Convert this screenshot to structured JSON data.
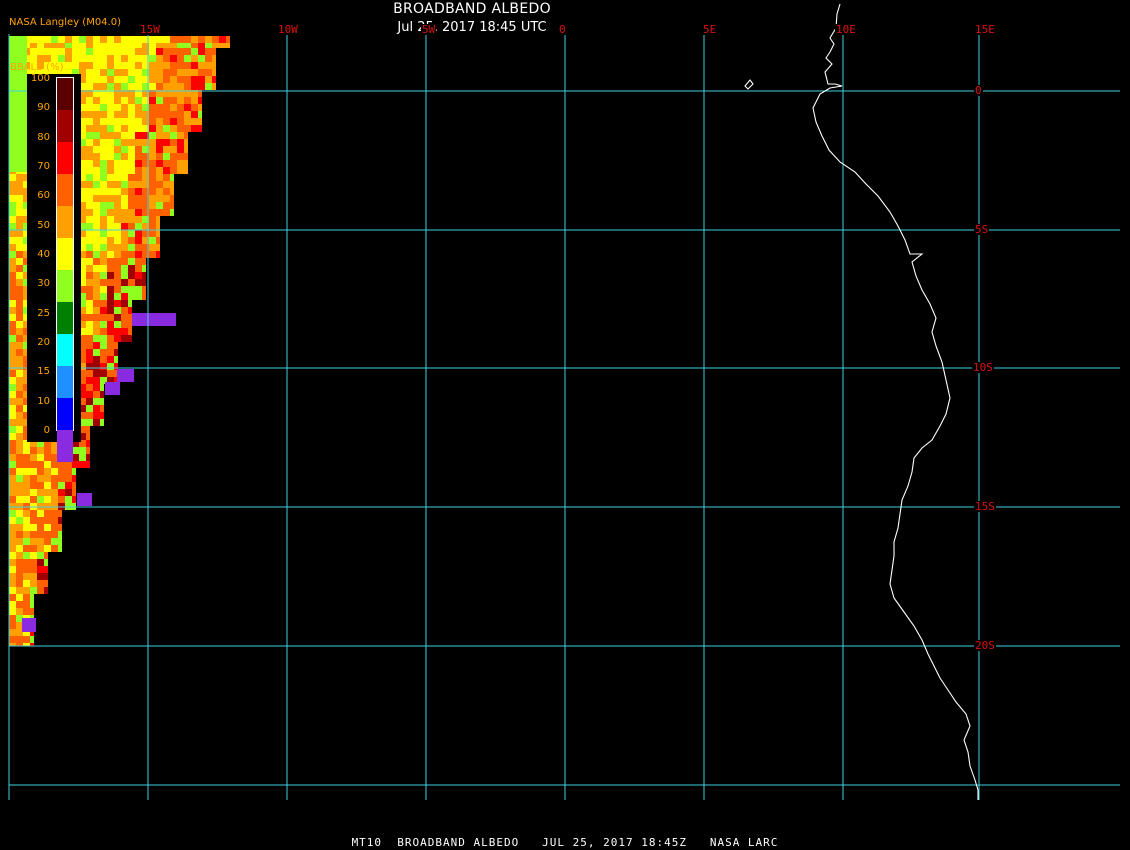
{
  "header": {
    "title": "BROADBAND ALBEDO",
    "timestamp": "Jul 25, 2017 18:45 UTC",
    "producer": "NASA Langley (M04.0)"
  },
  "footer": {
    "text": "MT10  BROADBAND ALBEDO   JUL 25, 2017 18:45Z   NASA LARC"
  },
  "map": {
    "projection": "lat-lon grid",
    "lon_labels": [
      "15W",
      "10W",
      "5W",
      "0",
      "5E",
      "10E",
      "15E"
    ],
    "lat_labels": [
      "0",
      "5S",
      "10S",
      "15S",
      "20S"
    ],
    "grid_color": "#40d0e0",
    "label_color": "#dd1010",
    "coastline_color": "#ffffff",
    "background_color": "#000000",
    "data_region": "western edge of scan, approx. 20W to 17W, 2N to 20S"
  },
  "legend": {
    "title": "BBALB (%)",
    "labels": [
      "100",
      "90",
      "80",
      "70",
      "60",
      "50",
      "40",
      "30",
      "25",
      "20",
      "15",
      "10",
      "0"
    ],
    "colors": [
      "#5a0000",
      "#a00000",
      "#ff0000",
      "#ff6000",
      "#ffa000",
      "#ffff00",
      "#90ff20",
      "#008000",
      "#00ffff",
      "#1e90ff",
      "#0000ff",
      "#8a2be2"
    ],
    "label_color": "#ffa500",
    "border_color": "#ffffff"
  }
}
